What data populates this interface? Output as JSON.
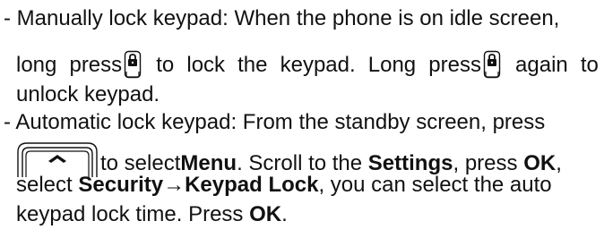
{
  "paragraph1": {
    "line1": "- Manually lock keypad: When the phone is on idle screen,",
    "line2": {
      "w1": "long",
      "w2": "press",
      "w3": "to",
      "w4": "lock",
      "w5": "the",
      "w6": "keypad.",
      "w7": "Long",
      "w8": "press",
      "w9": "again",
      "w10": "to"
    },
    "line3": "unlock keypad.",
    "icon": "keypad-lock-key-icon"
  },
  "paragraph2": {
    "line1": "- Automatic lock keypad: From the standby screen, press",
    "line2": {
      "t1": "to select ",
      "menu": "Menu",
      "t2": ". Scroll to the ",
      "settings": "Settings",
      "t3": ", press ",
      "ok": "OK",
      "t4": ","
    },
    "line3": {
      "t1": "select ",
      "path": "Security→Keypad Lock",
      "t2": ", you can select the auto"
    },
    "line4": {
      "t1": "keypad lock time. Press ",
      "ok": "OK",
      "t2": "."
    },
    "icon": "up-softkey-icon"
  }
}
